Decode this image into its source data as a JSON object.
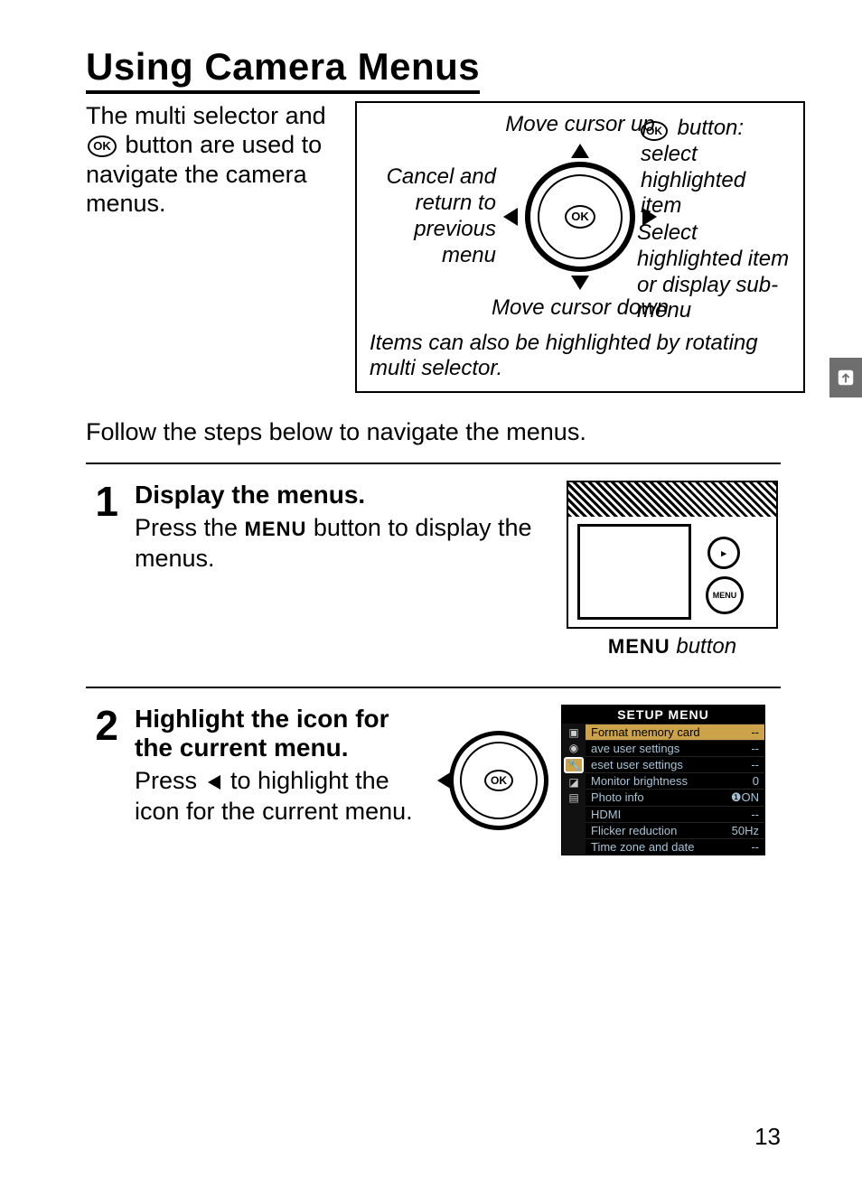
{
  "title": "Using Camera Menus",
  "intro_before": "The multi selector and ",
  "intro_after": " button are used to navigate the camera menus.",
  "ok_glyph": "OK",
  "diagram": {
    "up": "Move cursor up",
    "down": "Move cursor down",
    "left": "Cancel and return to previous menu",
    "right": "Select highlighted item or display sub-menu",
    "ok_btn": " button: select highlighted item",
    "caption": "Items can also be highlighted by rotating multi selector."
  },
  "follow": "Follow the steps below to navigate the menus.",
  "steps": [
    {
      "num": "1",
      "title": "Display the menus.",
      "text_before": "Press the ",
      "menu_word": "MENU",
      "text_after": " button to display the menus.",
      "caption_word": "MENU",
      "caption_after": " button"
    },
    {
      "num": "2",
      "title": "Highlight the icon for the current menu.",
      "text_before": "Press ",
      "text_after": " to highlight the icon for the current menu."
    }
  ],
  "setup": {
    "title": "SETUP MENU",
    "rows": [
      {
        "label": "Format memory card",
        "val": "--",
        "sel": true
      },
      {
        "label": "ave user settings",
        "val": "--"
      },
      {
        "label": "eset user settings",
        "val": "--"
      },
      {
        "label": "Monitor brightness",
        "val": "0"
      },
      {
        "label": "Photo info",
        "val": "❶ON"
      },
      {
        "label": "HDMI",
        "val": "--"
      },
      {
        "label": "Flicker reduction",
        "val": "50Hz"
      },
      {
        "label": "Time zone and date",
        "val": "--"
      }
    ]
  },
  "page_num": "13"
}
